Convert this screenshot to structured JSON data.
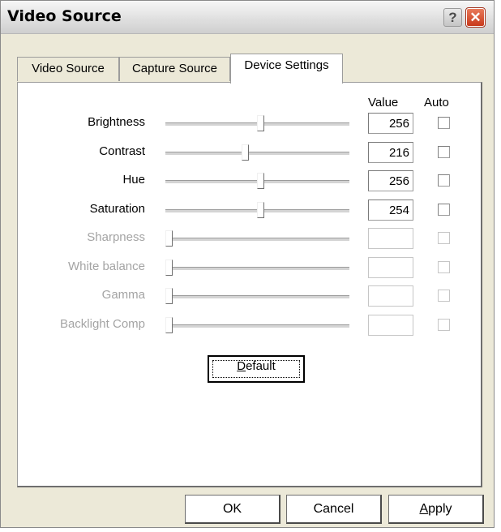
{
  "window": {
    "title": "Video Source"
  },
  "tabs": [
    {
      "label": "Video Source",
      "active": false
    },
    {
      "label": "Capture Source",
      "active": false
    },
    {
      "label": "Device Settings",
      "active": true
    }
  ],
  "columns": {
    "value": "Value",
    "auto": "Auto"
  },
  "settings": [
    {
      "label": "Brightness",
      "value": "256",
      "enabled": true,
      "slider_fraction": 0.52,
      "auto": false
    },
    {
      "label": "Contrast",
      "value": "216",
      "enabled": true,
      "slider_fraction": 0.43,
      "auto": false
    },
    {
      "label": "Hue",
      "value": "256",
      "enabled": true,
      "slider_fraction": 0.52,
      "auto": false
    },
    {
      "label": "Saturation",
      "value": "254",
      "enabled": true,
      "slider_fraction": 0.52,
      "auto": false
    },
    {
      "label": "Sharpness",
      "value": "",
      "enabled": false,
      "slider_fraction": 0.0,
      "auto": false
    },
    {
      "label": "White balance",
      "value": "",
      "enabled": false,
      "slider_fraction": 0.0,
      "auto": false
    },
    {
      "label": "Gamma",
      "value": "",
      "enabled": false,
      "slider_fraction": 0.0,
      "auto": false
    },
    {
      "label": "Backlight Comp",
      "value": "",
      "enabled": false,
      "slider_fraction": 0.0,
      "auto": false
    }
  ],
  "buttons": {
    "default_pre": "",
    "default_accel": "D",
    "default_post": "efault",
    "ok": "OK",
    "cancel": "Cancel",
    "apply_accel": "A",
    "apply_post": "pply"
  },
  "icons": {
    "help": "help-icon",
    "close": "close-icon"
  },
  "colors": {
    "close_button": "#c8391b",
    "disabled_text": "#a4a4a4"
  }
}
